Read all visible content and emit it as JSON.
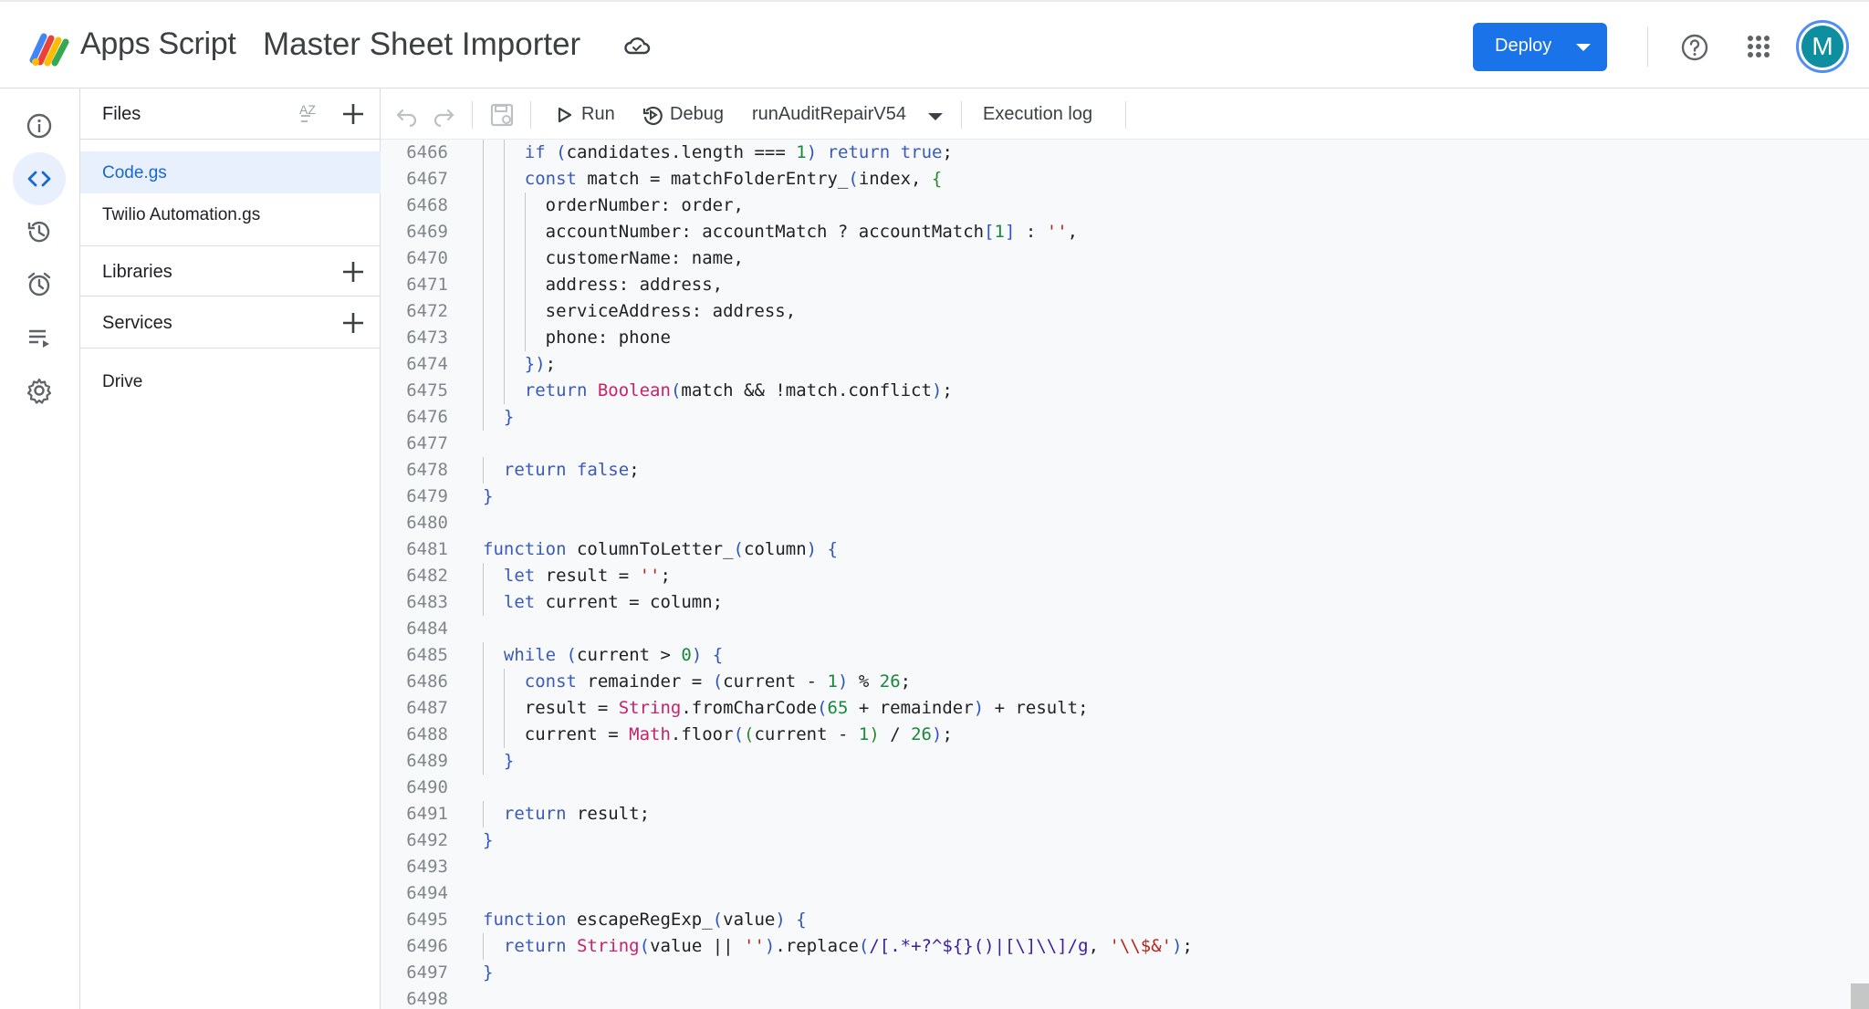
{
  "header": {
    "brand": "Apps Script",
    "project_title": "Master Sheet Importer",
    "deploy_label": "Deploy",
    "avatar_letter": "M",
    "brand_colors": [
      "#4285f4",
      "#ea4335",
      "#fbbc04",
      "#34a853"
    ],
    "accent": "#1a73e8"
  },
  "rail": {
    "items": [
      {
        "name": "overview",
        "icon": "info-icon"
      },
      {
        "name": "editor",
        "icon": "code-icon",
        "active": true
      },
      {
        "name": "project-history",
        "icon": "history-icon"
      },
      {
        "name": "triggers",
        "icon": "alarm-icon"
      },
      {
        "name": "executions",
        "icon": "executions-icon"
      },
      {
        "name": "project-settings",
        "icon": "gear-icon"
      }
    ]
  },
  "files_panel": {
    "files_header": "Files",
    "sort_icon_text": "AZ",
    "files": [
      {
        "name": "Code.gs",
        "active": true
      },
      {
        "name": "Twilio Automation.gs",
        "active": false
      }
    ],
    "libraries_label": "Libraries",
    "services_label": "Services",
    "drive_label": "Drive"
  },
  "toolbar": {
    "run_label": "Run",
    "debug_label": "Debug",
    "function_name": "runAuditRepairV54",
    "execution_log_label": "Execution log"
  },
  "editor": {
    "lines": [
      {
        "n": "6466",
        "code": "    if (candidates.length === 1) return true;"
      },
      {
        "n": "6467",
        "code": "    const match = matchFolderEntry_(index, {"
      },
      {
        "n": "6468",
        "code": "      orderNumber: order,"
      },
      {
        "n": "6469",
        "code": "      accountNumber: accountMatch ? accountMatch[1] : '',"
      },
      {
        "n": "6470",
        "code": "      customerName: name,"
      },
      {
        "n": "6471",
        "code": "      address: address,"
      },
      {
        "n": "6472",
        "code": "      serviceAddress: address,"
      },
      {
        "n": "6473",
        "code": "      phone: phone"
      },
      {
        "n": "6474",
        "code": "    });"
      },
      {
        "n": "6475",
        "code": "    return Boolean(match && !match.conflict);"
      },
      {
        "n": "6476",
        "code": "  }"
      },
      {
        "n": "6477",
        "code": ""
      },
      {
        "n": "6478",
        "code": "  return false;"
      },
      {
        "n": "6479",
        "code": "}"
      },
      {
        "n": "6480",
        "code": ""
      },
      {
        "n": "6481",
        "code": "function columnToLetter_(column) {"
      },
      {
        "n": "6482",
        "code": "  let result = '';"
      },
      {
        "n": "6483",
        "code": "  let current = column;"
      },
      {
        "n": "6484",
        "code": ""
      },
      {
        "n": "6485",
        "code": "  while (current > 0) {"
      },
      {
        "n": "6486",
        "code": "    const remainder = (current - 1) % 26;"
      },
      {
        "n": "6487",
        "code": "    result = String.fromCharCode(65 + remainder) + result;"
      },
      {
        "n": "6488",
        "code": "    current = Math.floor((current - 1) / 26);"
      },
      {
        "n": "6489",
        "code": "  }"
      },
      {
        "n": "6490",
        "code": ""
      },
      {
        "n": "6491",
        "code": "  return result;"
      },
      {
        "n": "6492",
        "code": "}"
      },
      {
        "n": "6493",
        "code": ""
      },
      {
        "n": "6494",
        "code": ""
      },
      {
        "n": "6495",
        "code": "function escapeRegExp_(value) {"
      },
      {
        "n": "6496",
        "code": "  return String(value || '').replace(/[.*+?^${}()|[\\]\\\\]/g, '\\\\$&');"
      },
      {
        "n": "6497",
        "code": "}"
      },
      {
        "n": "6498",
        "code": ""
      }
    ]
  }
}
